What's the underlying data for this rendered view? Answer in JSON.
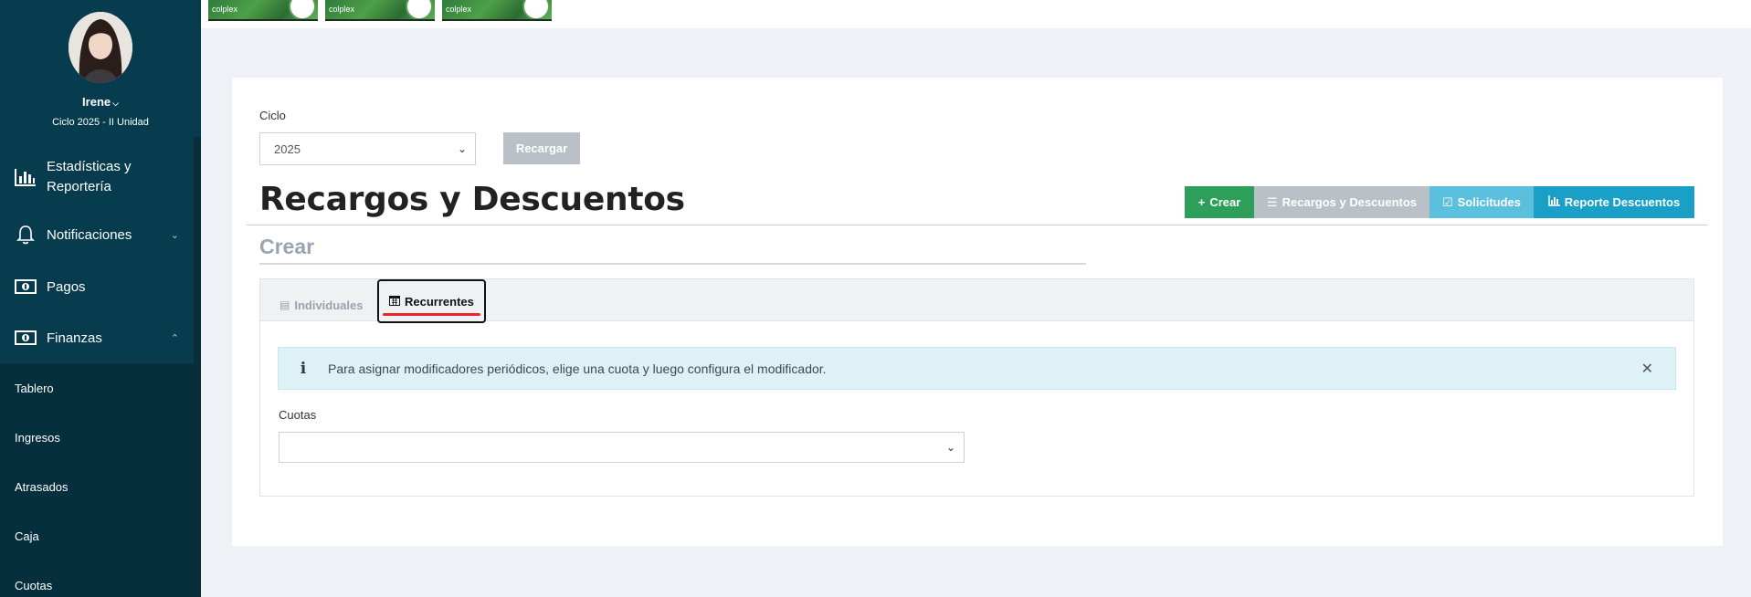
{
  "sidebar": {
    "user_name": "Irene",
    "cycle": "Ciclo 2025 - II Unidad",
    "items": [
      {
        "label": "Estadísticas y Reportería",
        "icon": "bar-chart-icon"
      },
      {
        "label": "Notificaciones",
        "icon": "bell-icon"
      },
      {
        "label": "Pagos",
        "icon": "money-icon"
      },
      {
        "label": "Finanzas",
        "icon": "money-icon"
      }
    ],
    "finanzas_subitems": [
      "Tablero",
      "Ingresos",
      "Atrasados",
      "Caja",
      "Cuotas"
    ]
  },
  "banners": [
    {
      "text": "colplex"
    },
    {
      "text": "colplex"
    },
    {
      "text": "colplex"
    }
  ],
  "filters": {
    "cycle_label": "Ciclo",
    "cycle_value": "2025",
    "reload_label": "Recargar"
  },
  "page": {
    "title": "Recargos y Descuentos",
    "subtitle": "Crear"
  },
  "actions": {
    "crear": "Crear",
    "recargos": "Recargos y Descuentos",
    "solicitudes": "Solicitudes",
    "reporte": "Reporte Descuentos"
  },
  "tabs": {
    "individuales": "Individuales",
    "recurrentes": "Recurrentes"
  },
  "alert": {
    "text": "Para asignar modificadores periódicos, elige una cuota y luego configura el modificador."
  },
  "cuotas": {
    "label": "Cuotas",
    "value": ""
  },
  "colors": {
    "sidebar": "#063c4e",
    "crear": "#2e9e5b",
    "recargos": "#b9c0c8",
    "solicitudes": "#5bc0de",
    "reporte": "#1a9fc7",
    "active_tab_underline": "#e8262d"
  }
}
